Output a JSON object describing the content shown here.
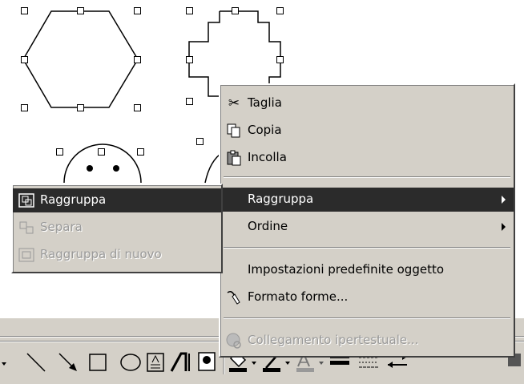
{
  "context_menu": {
    "items": [
      {
        "label": "Taglia",
        "icon": "scissors-icon",
        "enabled": true
      },
      {
        "label": "Copia",
        "icon": "copy-icon",
        "enabled": true
      },
      {
        "label": "Incolla",
        "icon": "paste-icon",
        "enabled": true
      },
      {
        "label": "Raggruppa",
        "icon": "",
        "enabled": true,
        "submenu": true,
        "highlighted": true
      },
      {
        "label": "Ordine",
        "icon": "",
        "enabled": true,
        "submenu": true
      },
      {
        "label": "Impostazioni predefinite oggetto",
        "icon": "",
        "enabled": true
      },
      {
        "label": "Formato forme...",
        "icon": "format-shape-icon",
        "enabled": true
      },
      {
        "label": "Collegamento ipertestuale...",
        "icon": "hyperlink-icon",
        "enabled": false
      }
    ]
  },
  "submenu": {
    "items": [
      {
        "label": "Raggruppa",
        "icon": "group-icon",
        "enabled": true,
        "highlighted": true
      },
      {
        "label": "Separa",
        "icon": "ungroup-icon",
        "enabled": false
      },
      {
        "label": "Raggruppa di nuovo",
        "icon": "regroup-icon",
        "enabled": false
      }
    ]
  },
  "colors": {
    "menu_bg": "#d4d0c8",
    "highlight": "#2b2b2b",
    "disabled": "#9a9a9a"
  }
}
